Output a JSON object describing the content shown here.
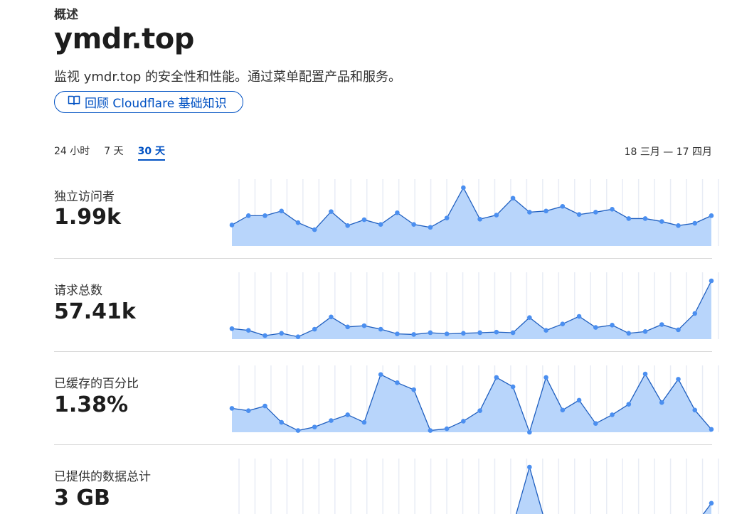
{
  "header": {
    "section_label": "概述",
    "site_title": "ymdr.top",
    "subtitle": "监视 ymdr.top 的安全性和性能。通过菜单配置产品和服务。",
    "review_button": "回顾 Cloudflare 基础知识",
    "review_icon": "book-icon"
  },
  "time_range": {
    "tabs": [
      {
        "label": "24 小时",
        "active": false
      },
      {
        "label": "7 天",
        "active": false
      },
      {
        "label": "30 天",
        "active": true
      }
    ],
    "date_range": "18 三月 — 17 四月"
  },
  "colors": {
    "accent": "#0051c3",
    "line": "#1f5fc0",
    "fill": "#b8d5fb",
    "point": "#4b8ff0",
    "grid": "#e8ecf5"
  },
  "metrics": [
    {
      "label": "独立访问者",
      "value": "1.99k"
    },
    {
      "label": "请求总数",
      "value": "57.41k"
    },
    {
      "label": "已缓存的百分比",
      "value": "1.38%"
    },
    {
      "label": "已提供的数据总计",
      "value": "3 GB"
    }
  ],
  "chart_data": [
    {
      "type": "area",
      "series": [
        {
          "values": [
            36,
            52,
            52,
            60,
            40,
            28,
            59,
            35,
            45,
            37,
            57,
            37,
            32,
            48,
            100,
            46,
            53,
            82,
            58,
            60,
            68,
            54,
            58,
            63,
            47,
            47,
            42,
            35,
            39,
            52
          ]
        }
      ]
    },
    {
      "type": "area",
      "series": [
        {
          "values": [
            18,
            15,
            6,
            10,
            4,
            17,
            38,
            21,
            23,
            17,
            9,
            8,
            11,
            9,
            10,
            11,
            12,
            11,
            37,
            15,
            26,
            39,
            20,
            24,
            10,
            13,
            25,
            16,
            44,
            100
          ]
        }
      ]
    },
    {
      "type": "area",
      "series": [
        {
          "values": [
            41,
            37,
            45,
            17,
            3,
            9,
            20,
            30,
            17,
            99,
            85,
            73,
            3,
            6,
            19,
            37,
            94,
            78,
            0,
            94,
            38,
            55,
            15,
            30,
            48,
            100,
            51,
            91,
            38,
            5
          ]
        }
      ]
    },
    {
      "type": "area",
      "series": [
        {
          "values": [
            0,
            0,
            0,
            0,
            0,
            0,
            0,
            0,
            0,
            0,
            0,
            0,
            0,
            0,
            0,
            0,
            0,
            0,
            100,
            0,
            0,
            0,
            0,
            0,
            0,
            0,
            0,
            0,
            0,
            38
          ]
        }
      ]
    }
  ]
}
